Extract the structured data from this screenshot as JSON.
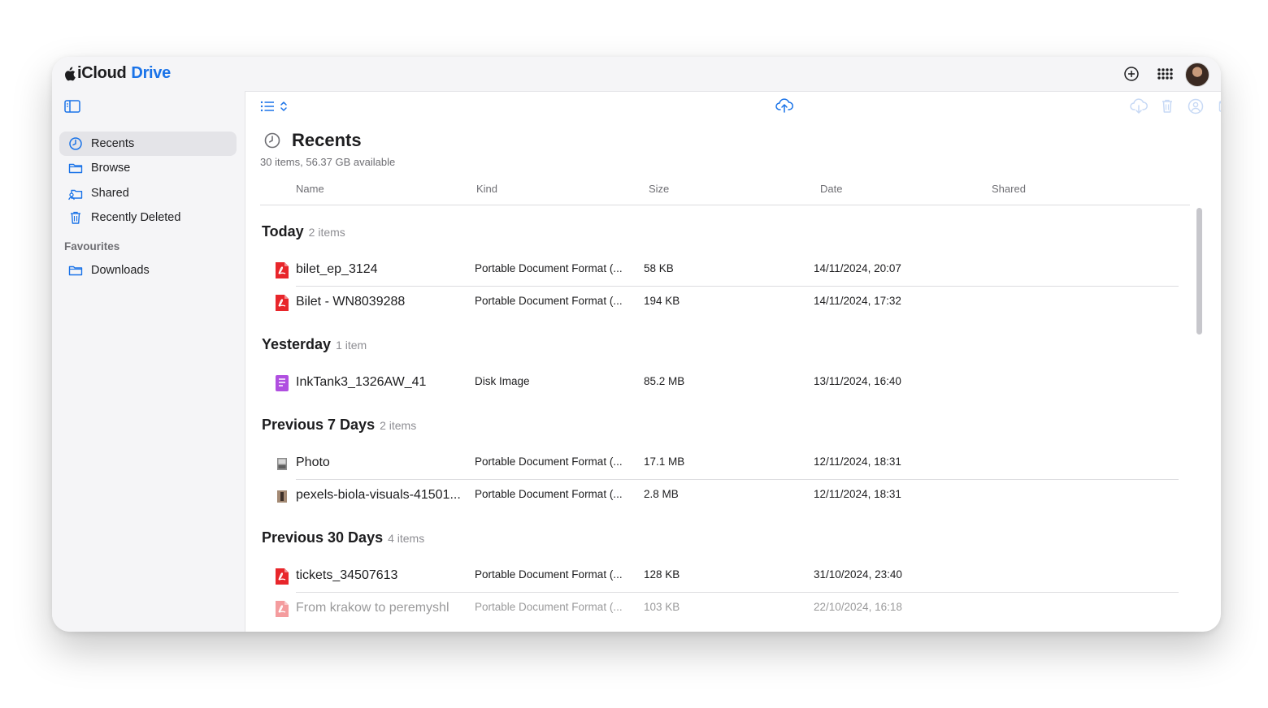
{
  "app": {
    "brand_main": "iCloud",
    "brand_product": "Drive",
    "accent_color": "#1a73e8",
    "top_icons": [
      "add-circle-icon",
      "app-grid-icon",
      "avatar"
    ]
  },
  "sidebar": {
    "items": [
      {
        "label": "Recents",
        "icon": "clock-icon",
        "active": true
      },
      {
        "label": "Browse",
        "icon": "folder-icon",
        "active": false
      },
      {
        "label": "Shared",
        "icon": "shared-folder-icon",
        "active": false
      },
      {
        "label": "Recently Deleted",
        "icon": "trash-icon",
        "active": false
      }
    ],
    "favourites_heading": "Favourites",
    "favourites": [
      {
        "label": "Downloads",
        "icon": "folder-icon"
      }
    ]
  },
  "toolbar": {
    "icons": [
      "list-view-icon",
      "sort-chevrons-icon",
      "upload-icon",
      "download-icon",
      "trash-icon",
      "share-person-icon",
      "mail-icon",
      "more-icon"
    ]
  },
  "main": {
    "title": "Recents",
    "subtitle": "30 items, 56.37 GB available",
    "columns": [
      "Name",
      "Kind",
      "Size",
      "Date",
      "Shared"
    ],
    "groups": [
      {
        "title": "Today",
        "count": "2 items",
        "rows": [
          {
            "icon": "pdf-icon",
            "name": "bilet_ep_3124",
            "kind": "Portable Document Format (...",
            "size": "58 KB",
            "date": "14/11/2024, 20:07"
          },
          {
            "icon": "pdf-icon",
            "name": "Bilet - WN8039288",
            "kind": "Portable Document Format (...",
            "size": "194 KB",
            "date": "14/11/2024, 17:32"
          }
        ]
      },
      {
        "title": "Yesterday",
        "count": "1 item",
        "rows": [
          {
            "icon": "disk-image-icon",
            "name": "InkTank3_1326AW_41",
            "kind": "Disk Image",
            "size": "85.2 MB",
            "date": "13/11/2024, 16:40"
          }
        ]
      },
      {
        "title": "Previous 7 Days",
        "count": "2 items",
        "rows": [
          {
            "icon": "photo-thumbnail-icon",
            "name": "Photo",
            "kind": "Portable Document Format (...",
            "size": "17.1 MB",
            "date": "12/11/2024, 18:31"
          },
          {
            "icon": "photo-thumbnail-icon",
            "name": "pexels-biola-visuals-41501...",
            "kind": "Portable Document Format (...",
            "size": "2.8 MB",
            "date": "12/11/2024, 18:31"
          }
        ]
      },
      {
        "title": "Previous 30 Days",
        "count": "4 items",
        "rows": [
          {
            "icon": "pdf-icon",
            "name": "tickets_34507613",
            "kind": "Portable Document Format (...",
            "size": "128 KB",
            "date": "31/10/2024, 23:40"
          },
          {
            "icon": "pdf-icon",
            "name": "From krakow to peremyshl",
            "kind": "Portable Document Format (...",
            "size": "103 KB",
            "date": "22/10/2024, 16:18"
          }
        ]
      }
    ]
  }
}
